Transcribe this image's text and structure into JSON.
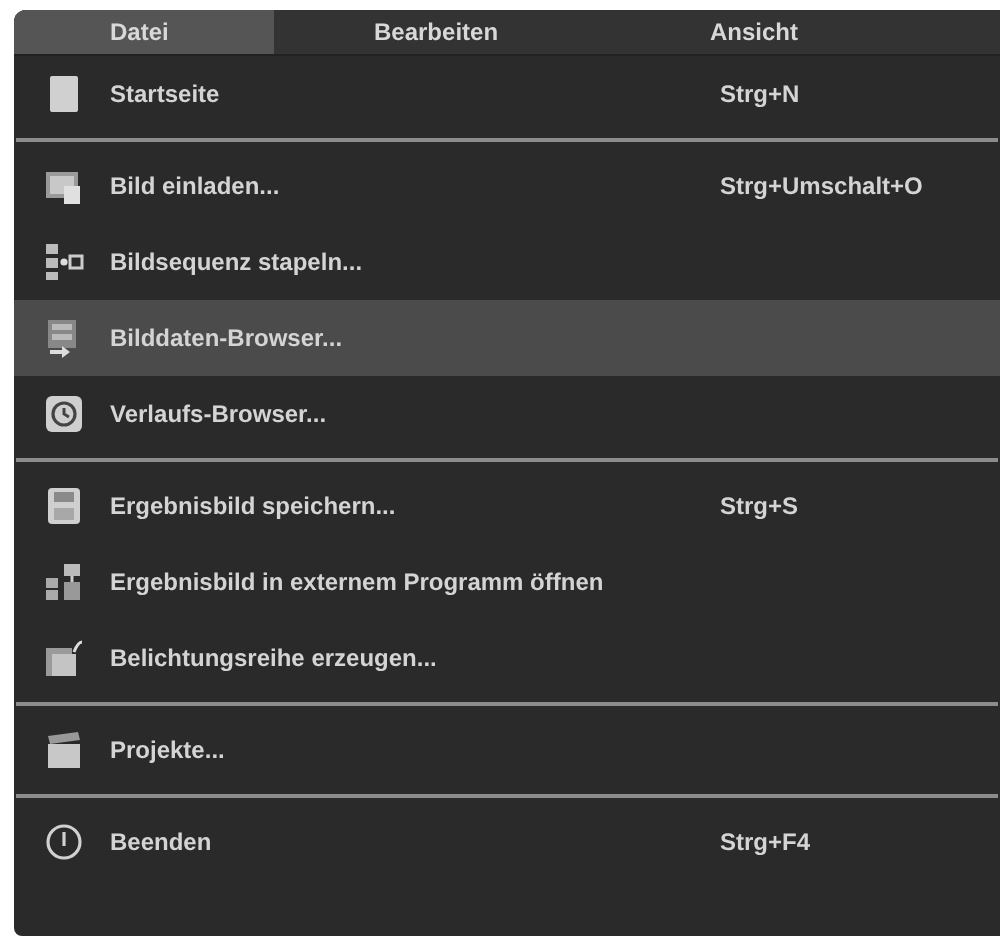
{
  "menu_bar": [
    {
      "label": "Datei",
      "selected": true
    },
    {
      "label": "Bearbeiten",
      "selected": false
    },
    {
      "label": "Ansicht",
      "selected": false
    }
  ],
  "menu_items": [
    {
      "kind": "item",
      "label": "Startseite",
      "shortcut": "Strg+N",
      "highlighted": false
    },
    {
      "kind": "separator"
    },
    {
      "kind": "item",
      "label": "Bild einladen...",
      "shortcut": "Strg+Umschalt+O",
      "highlighted": false
    },
    {
      "kind": "item",
      "label": "Bildsequenz stapeln...",
      "highlighted": false
    },
    {
      "kind": "item",
      "label": "Bilddaten-Browser...",
      "highlighted": true
    },
    {
      "kind": "item",
      "label": "Verlaufs-Browser...",
      "highlighted": false
    },
    {
      "kind": "separator"
    },
    {
      "kind": "item",
      "label": "Ergebnisbild speichern...",
      "shortcut": "Strg+S",
      "highlighted": false
    },
    {
      "kind": "item",
      "label": "Ergebnisbild in externem Programm öffnen",
      "highlighted": false
    },
    {
      "kind": "item",
      "label": "Belichtungsreihe erzeugen...",
      "highlighted": false
    },
    {
      "kind": "separator"
    },
    {
      "kind": "item",
      "label": "Projekte...",
      "highlighted": false
    },
    {
      "kind": "separator"
    },
    {
      "kind": "item",
      "label": "Beenden",
      "shortcut": "Strg+F4",
      "highlighted": false
    }
  ]
}
